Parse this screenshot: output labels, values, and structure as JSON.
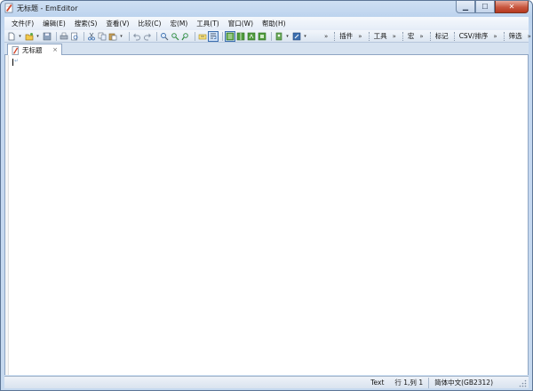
{
  "window": {
    "title": "无标题 - EmEditor",
    "caption_buttons": {
      "minimize": "▁",
      "maximize": "☐",
      "close": "✕"
    }
  },
  "menu": {
    "items": [
      "文件(F)",
      "编辑(E)",
      "搜索(S)",
      "查看(V)",
      "比较(C)",
      "宏(M)",
      "工具(T)",
      "窗口(W)",
      "帮助(H)"
    ]
  },
  "toolbar": {
    "groups": [
      "插件",
      "工具",
      "宏",
      "标记",
      "CSV/排序",
      "筛选"
    ],
    "chevron": "»",
    "dropdown_arrow": "▾",
    "icons": [
      "new-file-icon",
      "open-folder-icon",
      "save-icon",
      "print-icon",
      "print-preview-icon",
      "cut-icon",
      "copy-icon",
      "paste-icon",
      "undo-icon",
      "redo-icon",
      "find-icon",
      "find-next-icon",
      "find-prev-icon",
      "highlight-icon",
      "word-wrap-icon",
      "view-mode-icon",
      "split-icon",
      "sync-icon",
      "workspace-icon",
      "macro-icon",
      "tools-icon"
    ]
  },
  "tabs": [
    {
      "label": "无标题",
      "close": "×",
      "active": true
    }
  ],
  "editor": {
    "content": "",
    "eol_mark": "↵"
  },
  "status": {
    "mode": "Text",
    "position": "行 1,列 1",
    "encoding": "简体中文(GB2312)"
  },
  "colors": {
    "frame": "#c4d8f0",
    "close_button": "#c8573f",
    "accent": "#3c6fb0"
  }
}
